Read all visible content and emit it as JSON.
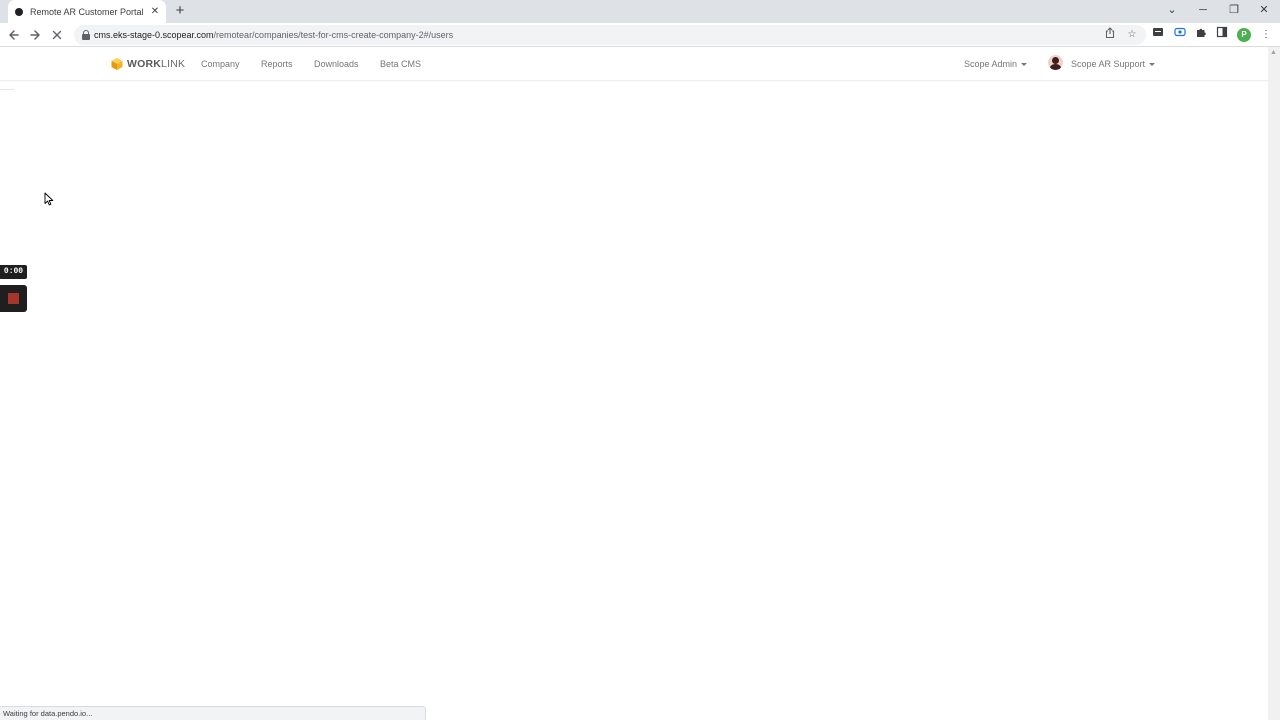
{
  "browser": {
    "tab_title": "Remote AR Customer Portal",
    "tab_close": "✕",
    "new_tab": "+",
    "url_host": "cms.eks-stage-0.scopear.com",
    "url_path": "/remotear/companies/test-for-cms-create-company-2#/users",
    "profile_initial": "P",
    "status_text": "Waiting for data.pendo.io..."
  },
  "site_nav": {
    "logo_bold": "WORK",
    "logo_light": "LINK",
    "links": [
      "Company",
      "Reports",
      "Downloads",
      "Beta CMS"
    ],
    "admin_menu": "Scope Admin",
    "user_menu": "Scope AR Support"
  },
  "recorder": {
    "timer": "0:00"
  },
  "colors": {
    "logo_accent": "#f5b324",
    "recorder_stop": "#c0392b",
    "profile": "#4caf50"
  }
}
